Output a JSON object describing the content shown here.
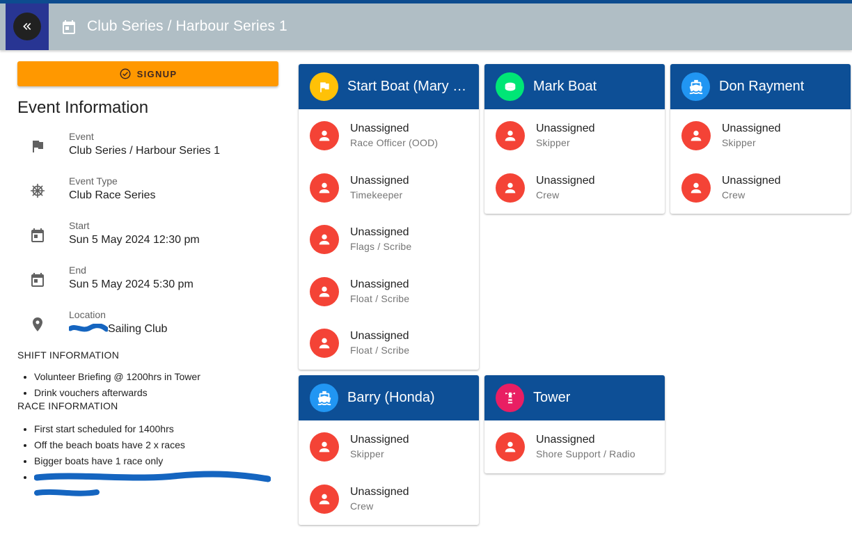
{
  "header": {
    "title": "Club Series / Harbour Series 1"
  },
  "signup": {
    "label": "SIGNUP"
  },
  "event_info": {
    "title": "Event Information",
    "items": [
      {
        "label": "Event",
        "value": "Club Series / Harbour Series 1",
        "icon": "flag-icon"
      },
      {
        "label": "Event Type",
        "value": "Club Race Series",
        "icon": "ship-wheel-icon"
      },
      {
        "label": "Start",
        "value": "Sun 5 May 2024 12:30 pm",
        "icon": "calendar-icon"
      },
      {
        "label": "End",
        "value": "Sun 5 May 2024 5:30 pm",
        "icon": "calendar-icon"
      },
      {
        "label": "Location",
        "value": "Sailing Club",
        "icon": "location-pin-icon"
      }
    ]
  },
  "shift_info": {
    "heading": "SHIFT INFORMATION",
    "items": [
      "Volunteer Briefing @ 1200hrs in Tower",
      "Drink vouchers afterwards"
    ]
  },
  "race_info": {
    "heading": "RACE INFORMATION",
    "items": [
      "First start scheduled for 1400hrs",
      "Off the beach boats have 2 x races",
      "Bigger boats have 1 race only"
    ]
  },
  "colors": {
    "header_bg": "#b0bec5",
    "nav_block": "#283593",
    "signup": "#ff9800",
    "card_header": "#0d4f96",
    "unassigned_avatar": "#f44336"
  },
  "cards": [
    {
      "title": "Start Boat (Mary …",
      "icon": "flag-icon",
      "icon_color": "#ffc107",
      "slots": [
        {
          "name": "Unassigned",
          "role": "Race Officer (OOD)"
        },
        {
          "name": "Unassigned",
          "role": "Timekeeper"
        },
        {
          "name": "Unassigned",
          "role": "Flags / Scribe"
        },
        {
          "name": "Unassigned",
          "role": "Float / Scribe"
        },
        {
          "name": "Unassigned",
          "role": "Float / Scribe"
        }
      ]
    },
    {
      "title": "Mark Boat",
      "icon": "buoy-icon",
      "icon_color": "#00e676",
      "slots": [
        {
          "name": "Unassigned",
          "role": "Skipper"
        },
        {
          "name": "Unassigned",
          "role": "Crew"
        }
      ]
    },
    {
      "title": "Don Rayment",
      "icon": "boat-icon",
      "icon_color": "#2196f3",
      "slots": [
        {
          "name": "Unassigned",
          "role": "Skipper"
        },
        {
          "name": "Unassigned",
          "role": "Crew"
        }
      ]
    },
    {
      "title": "Barry (Honda)",
      "icon": "boat-icon",
      "icon_color": "#2196f3",
      "slots": [
        {
          "name": "Unassigned",
          "role": "Skipper"
        },
        {
          "name": "Unassigned",
          "role": "Crew"
        }
      ]
    },
    {
      "title": "Tower",
      "icon": "lighthouse-icon",
      "icon_color": "#e91e63",
      "slots": [
        {
          "name": "Unassigned",
          "role": "Shore Support / Radio"
        }
      ]
    }
  ]
}
